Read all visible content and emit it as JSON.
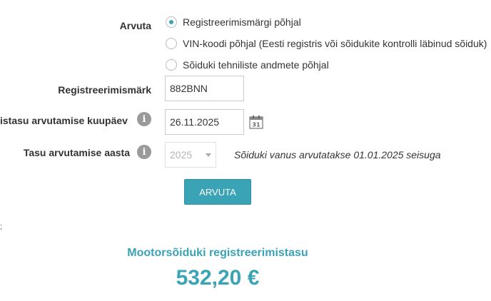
{
  "form": {
    "calc_label": "Arvuta",
    "radio_options": [
      {
        "label": "Registreerimismärgi põhjal",
        "checked": true
      },
      {
        "label": "VIN-koodi põhjal (Eesti registris või sõidukite kontrolli läbinud sõiduk)",
        "checked": false
      },
      {
        "label": "Sõiduki tehniliste andmete põhjal",
        "checked": false
      }
    ],
    "reg_label": "Registreerimismärk",
    "reg_value": "882BNN",
    "date_label": "istasu arvutamise kuupäev",
    "date_value": "26.11.2025",
    "year_label": "Tasu arvutamise aasta",
    "year_value": "2025",
    "age_note": "Sõiduki vanus arvutatakse 01.01.2025 seisuga",
    "button_label": "ARVUTA",
    "info_glyph": "i",
    "calendar_day": "31",
    "stray_mark": ";"
  },
  "result": {
    "title": "Mootorsõiduki registreerimistasu",
    "value": "532,20 €"
  },
  "colors": {
    "accent": "#3aa3b6"
  }
}
